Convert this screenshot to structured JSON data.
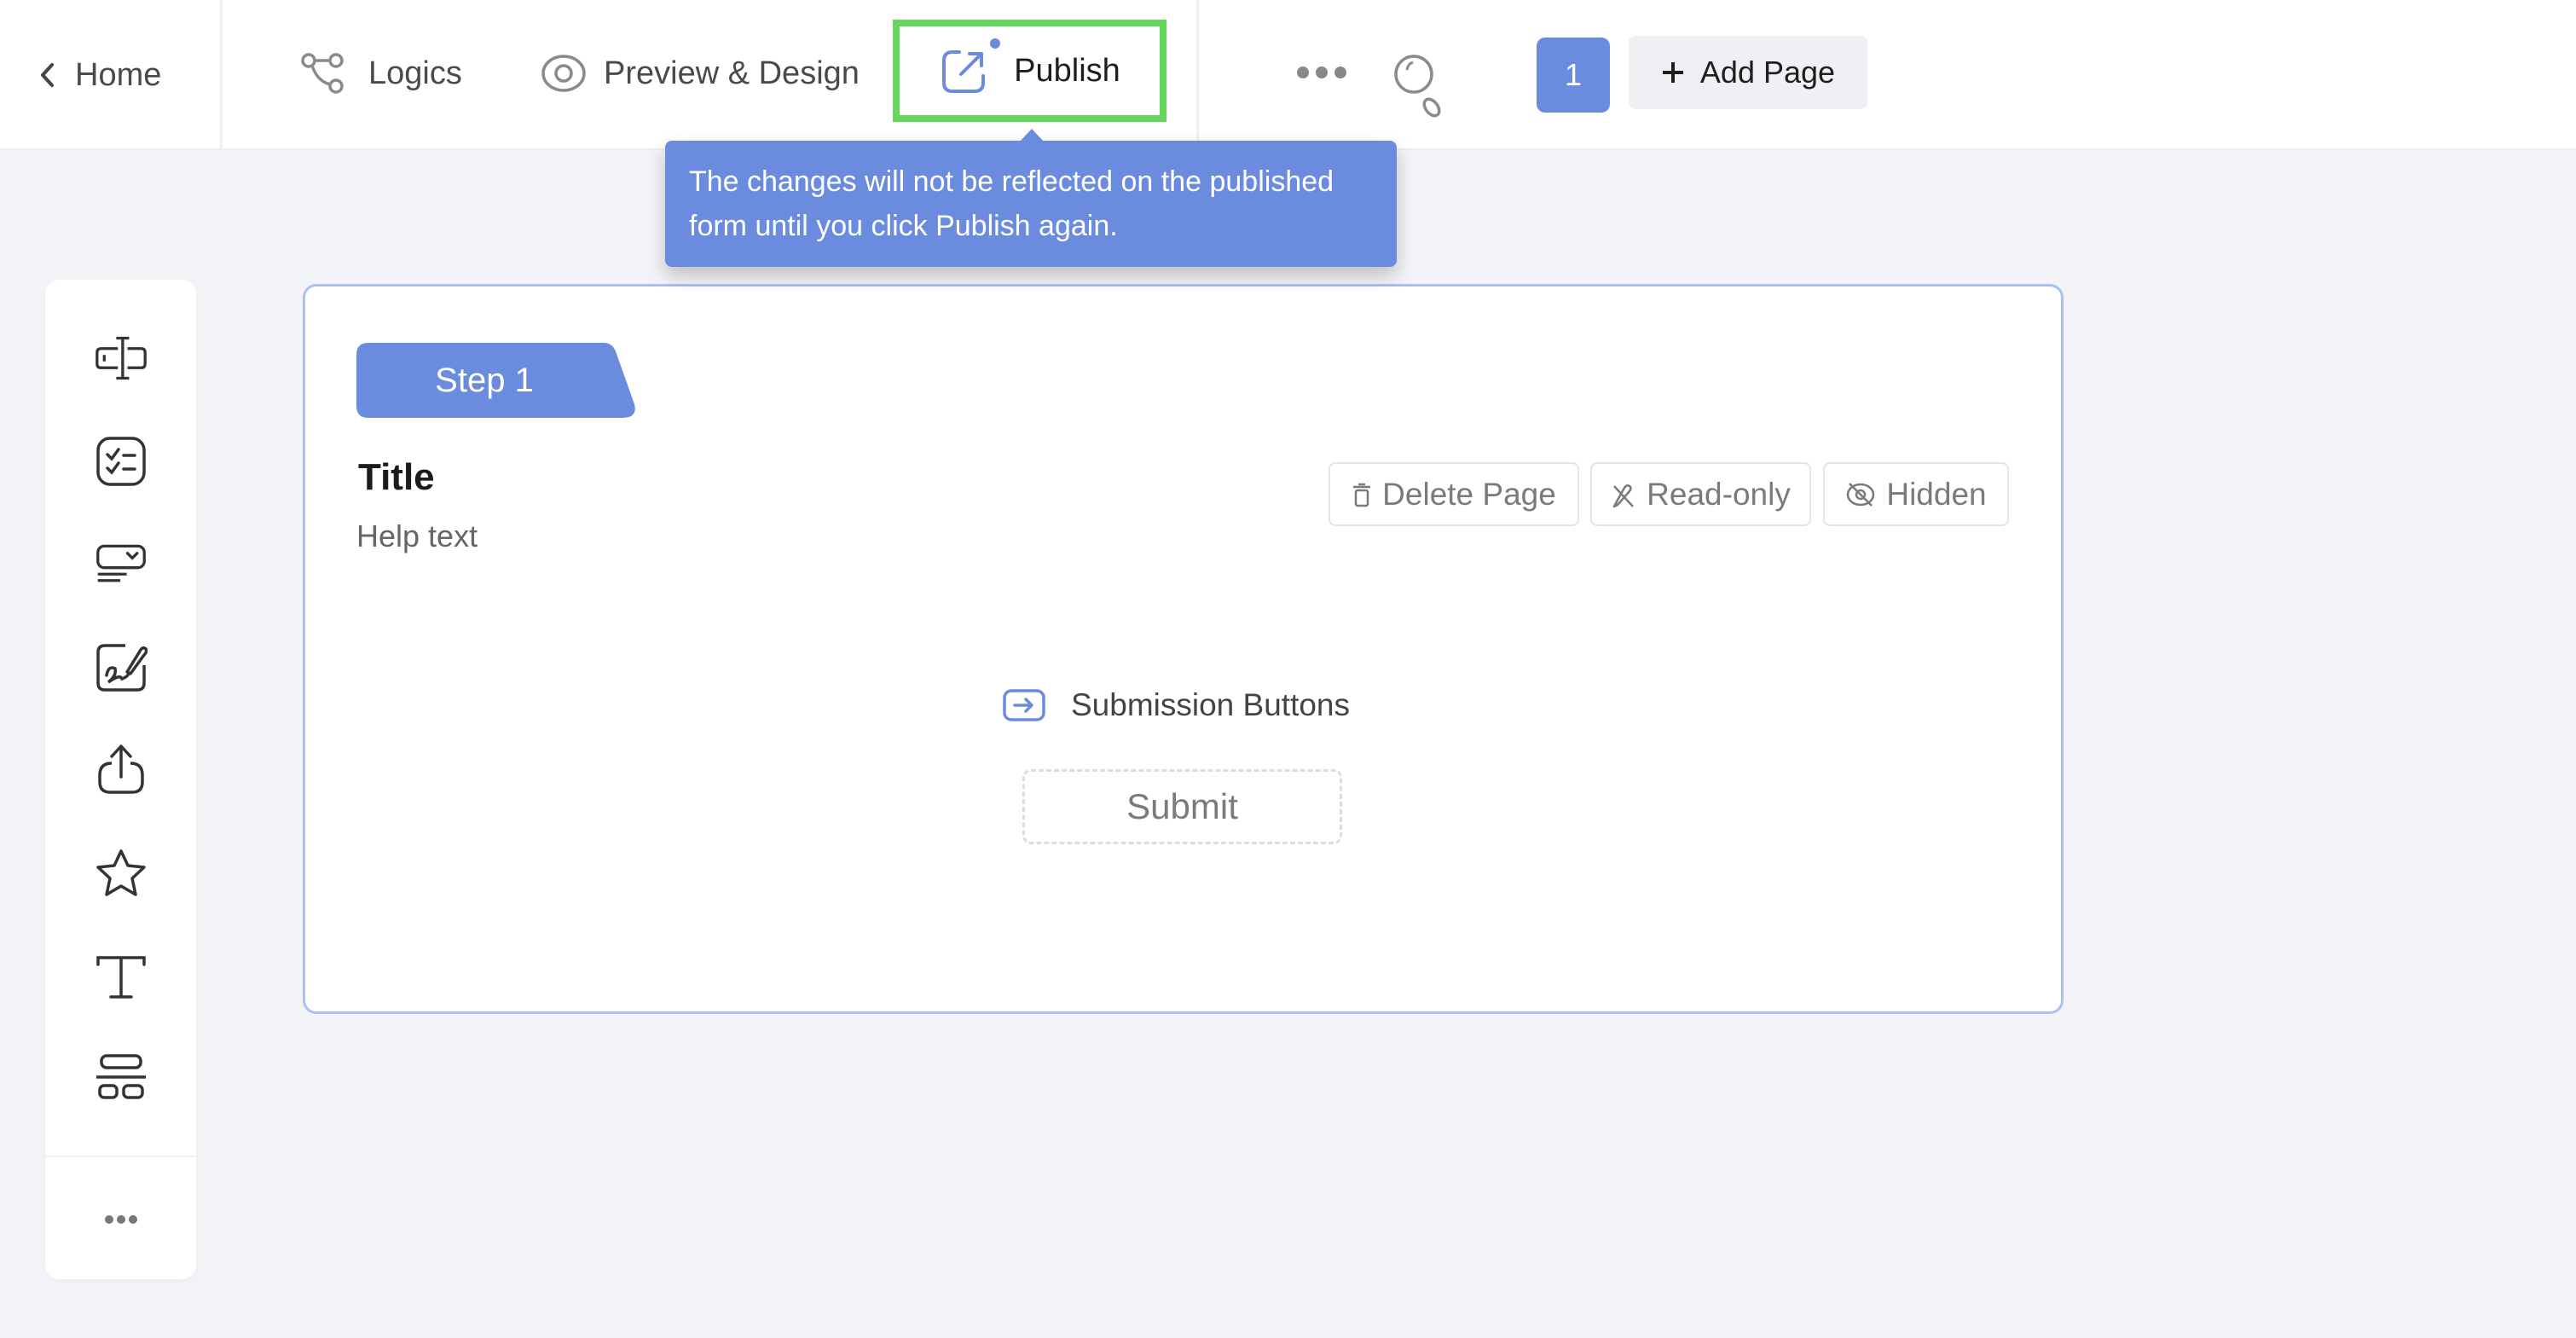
{
  "header": {
    "home_label": "Home",
    "nav": [
      {
        "label": "Logics",
        "icon": "logic-flow-icon"
      },
      {
        "label": "Preview & Design",
        "icon": "eye-icon"
      },
      {
        "label": "Publish",
        "icon": "external-link-icon",
        "highlighted": true,
        "has_notification_dot": true
      }
    ],
    "more_icon": "more-horizontal-icon",
    "search_icon": "search-icon",
    "page_number": "1",
    "add_page_label": "Add Page"
  },
  "tooltip": {
    "text_line1": "The changes will not be reflected on the published",
    "text_line2": "form until you click Publish again."
  },
  "sidebar": {
    "items": [
      {
        "name": "text-input-icon"
      },
      {
        "name": "checklist-icon"
      },
      {
        "name": "dropdown-icon"
      },
      {
        "name": "signature-icon"
      },
      {
        "name": "upload-icon"
      },
      {
        "name": "star-rating-icon"
      },
      {
        "name": "text-icon"
      },
      {
        "name": "layout-icon"
      }
    ],
    "more_icon": "more-horizontal-icon"
  },
  "card": {
    "step_label": "Step 1",
    "title": "Title",
    "help_text": "Help text",
    "buttons": [
      {
        "label": "Delete Page",
        "icon": "trash-icon"
      },
      {
        "label": "Read-only",
        "icon": "pencil-off-icon"
      },
      {
        "label": "Hidden",
        "icon": "eye-off-icon"
      }
    ],
    "submission_label": "Submission Buttons",
    "submit_label": "Submit"
  },
  "colors": {
    "accent": "#6b8cde",
    "highlight_border": "#66d65c",
    "background": "#f3f4f7",
    "card_border": "#a9c1f0"
  }
}
